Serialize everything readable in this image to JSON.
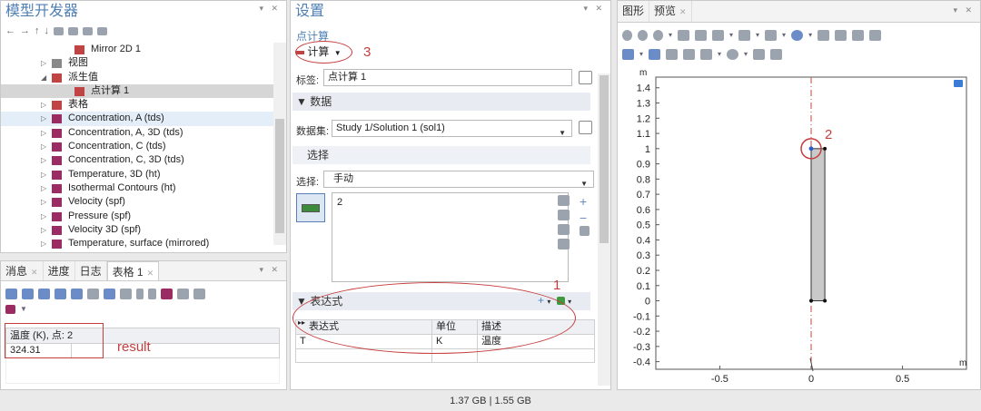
{
  "model_builder": {
    "title": "模型开发器",
    "nav_icons": [
      "←",
      "→",
      "↑",
      "↓"
    ],
    "tree": [
      {
        "label": "Mirror 2D 1",
        "indent": 2,
        "icon": "mirror-icon",
        "color": "#c04444",
        "expand": ""
      },
      {
        "label": "视图",
        "indent": 1,
        "icon": "view-icon",
        "color": "#888888",
        "expand": "▷"
      },
      {
        "label": "派生值",
        "indent": 1,
        "icon": "derived-values-icon",
        "color": "#c04444",
        "expand": "◢"
      },
      {
        "label": "点计算 1",
        "indent": 2,
        "icon": "point-eval-icon",
        "color": "#c04444",
        "expand": "",
        "selected": true
      },
      {
        "label": "表格",
        "indent": 1,
        "icon": "table-icon",
        "color": "#c04444",
        "expand": "▷"
      },
      {
        "label": "Concentration, A (tds)",
        "indent": 1,
        "icon": "plot-group-icon",
        "color": "#9a2c63",
        "expand": "▷",
        "highlight": true
      },
      {
        "label": "Concentration, A, 3D (tds)",
        "indent": 1,
        "icon": "plot-group-3d-icon",
        "color": "#9a2c63",
        "expand": "▷"
      },
      {
        "label": "Concentration, C (tds)",
        "indent": 1,
        "icon": "plot-group-icon",
        "color": "#9a2c63",
        "expand": "▷"
      },
      {
        "label": "Concentration, C, 3D (tds)",
        "indent": 1,
        "icon": "plot-group-3d-icon",
        "color": "#9a2c63",
        "expand": "▷"
      },
      {
        "label": "Temperature, 3D (ht)",
        "indent": 1,
        "icon": "plot-group-3d-icon",
        "color": "#9a2c63",
        "expand": "▷"
      },
      {
        "label": "Isothermal Contours (ht)",
        "indent": 1,
        "icon": "plot-group-icon",
        "color": "#9a2c63",
        "expand": "▷"
      },
      {
        "label": "Velocity (spf)",
        "indent": 1,
        "icon": "plot-group-icon",
        "color": "#9a2c63",
        "expand": "▷"
      },
      {
        "label": "Pressure (spf)",
        "indent": 1,
        "icon": "plot-group-icon",
        "color": "#9a2c63",
        "expand": "▷"
      },
      {
        "label": "Velocity 3D (spf)",
        "indent": 1,
        "icon": "plot-group-3d-icon",
        "color": "#9a2c63",
        "expand": "▷"
      },
      {
        "label": "Temperature, surface (mirrored)",
        "indent": 1,
        "icon": "plot-group-icon",
        "color": "#9a2c63",
        "expand": "▷"
      }
    ]
  },
  "messages": {
    "tabs": [
      {
        "label": "消息",
        "close": "✕"
      },
      {
        "label": "进度",
        "close": ""
      },
      {
        "label": "日志",
        "close": ""
      },
      {
        "label": "表格 1",
        "close": "✕",
        "active": true
      }
    ],
    "table_header": "温度 (K), 点: 2",
    "table_value": "324.31",
    "result_note": "result"
  },
  "settings": {
    "title": "设置",
    "subtitle": "点计算",
    "compute_label": "计算",
    "compute_arrow": "▼",
    "note_3": "3",
    "label_field_label": "标签:",
    "label_field_value": "点计算 1",
    "data_section": "数据",
    "dataset_label": "数据集:",
    "dataset_value": "Study 1/Solution 1 (sol1)",
    "selection_section": "选择",
    "selection_label": "选择:",
    "selection_value": "手动",
    "selection_item": "2",
    "note_1": "1",
    "expr_section": "表达式",
    "expr_headers": [
      "表达式",
      "单位",
      "描述"
    ],
    "expr_row": [
      "T",
      "K",
      "温度"
    ]
  },
  "graphics": {
    "tabs": [
      {
        "label": "图形"
      },
      {
        "label": "预览",
        "close": "✕"
      }
    ],
    "axis_unit_y": "m",
    "axis_unit_x": "m",
    "note_2": "2"
  },
  "chart_data": {
    "type": "line",
    "title": "",
    "xlabel": "m",
    "ylabel": "m",
    "xlim": [
      -0.85,
      0.85
    ],
    "ylim": [
      -0.45,
      1.47
    ],
    "x_ticks": [
      -0.5,
      0,
      0.5,
      1
    ],
    "y_ticks": [
      -0.4,
      -0.3,
      -0.2,
      -0.1,
      0,
      0.1,
      0.2,
      0.3,
      0.4,
      0.5,
      0.6,
      0.7,
      0.8,
      0.9,
      1,
      1.1,
      1.2,
      1.3,
      1.4
    ],
    "geometry": {
      "rect_x": [
        0,
        0.075
      ],
      "rect_y": [
        0,
        1
      ]
    },
    "points": [
      {
        "x": 0,
        "y": 0
      },
      {
        "x": 0.075,
        "y": 0
      },
      {
        "x": 0,
        "y": 1
      },
      {
        "x": 0.075,
        "y": 1
      }
    ],
    "highlighted_point": {
      "x": 0,
      "y": 1
    },
    "symmetry_axis_x": 0,
    "fill_color": "#c9c9c9",
    "axis_color": "#c4473b"
  },
  "status": {
    "memory": "1.37 GB | 1.55 GB"
  }
}
